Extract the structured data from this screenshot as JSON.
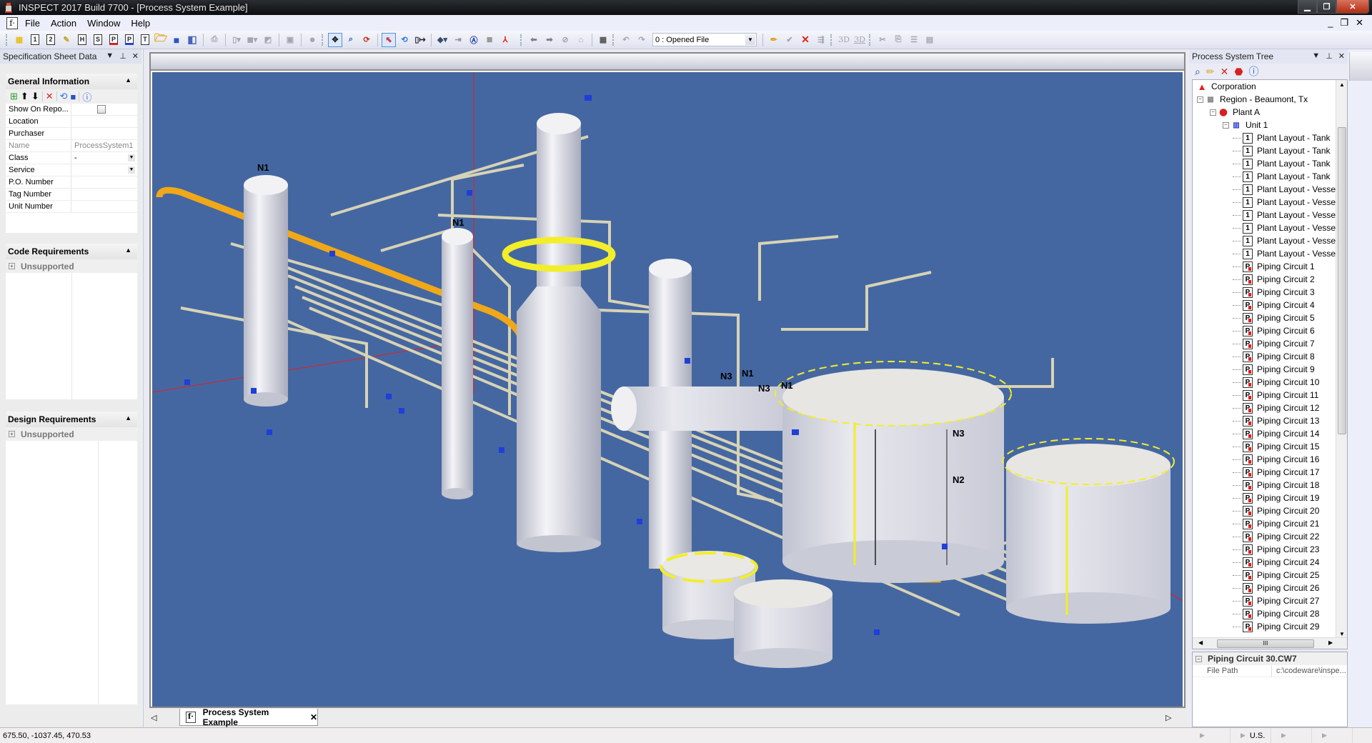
{
  "window": {
    "title": "INSPECT 2017 Build 7700 - [Process System Example]",
    "minimize_icon": "minimize-icon",
    "maximize_icon": "restore-icon",
    "close_icon": "close-icon"
  },
  "menubar": {
    "items": [
      {
        "label": "File",
        "accel": "F"
      },
      {
        "label": "Action",
        "accel": "A"
      },
      {
        "label": "Window",
        "accel": "W"
      },
      {
        "label": "Help",
        "accel": "H"
      }
    ],
    "mdi_controls": [
      "_",
      "❐",
      "✕"
    ]
  },
  "toolbar": {
    "buttons": [
      "new-project-icon",
      "tank-1-icon",
      "tank-2-icon",
      "wizard-icon",
      "heat-exchanger-icon",
      "s-icon",
      "piping-p3-icon",
      "piping-p4-icon",
      "t-icon",
      "open-icon",
      "save-icon",
      "save-all-icon",
      "print-icon",
      "report-icon",
      "component-icon",
      "edit-icon",
      "disk-icon",
      "sphere-icon",
      "pan-icon",
      "zoom-icon",
      "rotate-icon",
      "select-icon",
      "refresh-icon",
      "dimension-icon",
      "cube-icon",
      "arrow-right-icon",
      "lock-icon",
      "square-icon",
      "axis-icon",
      "back-icon",
      "forward-icon",
      "sync-icon",
      "home-icon",
      "calculator-icon",
      "undo-icon",
      "redo-icon",
      "pencil-icon",
      "check-edit-icon",
      "delete-icon",
      "merge-icon",
      "3d-icon",
      "3d-export-icon",
      "cut-icon",
      "copy-icon",
      "list-icon",
      "stack-icon"
    ],
    "file_select": {
      "value": "0 : Opened File"
    },
    "labels": {
      "b3d": "3D",
      "b3d2": "3D",
      "h": "H",
      "s": "S",
      "t": "T",
      "one": "1",
      "two": "2",
      "p3": "P",
      "p4": "P"
    }
  },
  "spec_sheet": {
    "title": "Specification Sheet Data",
    "general": {
      "title": "General Information",
      "rows": [
        {
          "key": "Show On Repo...",
          "value": "",
          "type": "checkbox",
          "checked": false
        },
        {
          "key": "Location",
          "value": ""
        },
        {
          "key": "Purchaser",
          "value": ""
        },
        {
          "key": "Name",
          "value": "ProcessSystem1",
          "dim": true
        },
        {
          "key": "Class",
          "value": "-",
          "type": "dropdown"
        },
        {
          "key": "Service",
          "value": "",
          "type": "dropdown"
        },
        {
          "key": "P.O. Number",
          "value": ""
        },
        {
          "key": "Tag Number",
          "value": ""
        },
        {
          "key": "Unit Number",
          "value": ""
        }
      ]
    },
    "code": {
      "title": "Code Requirements",
      "group": "Unsupported"
    },
    "design": {
      "title": "Design Requirements",
      "group": "Unsupported"
    }
  },
  "document": {
    "tab_label": "Process System Example",
    "nozzle_labels": [
      {
        "text": "N1"
      },
      {
        "text": "N1"
      },
      {
        "text": "N3"
      },
      {
        "text": "N1"
      },
      {
        "text": "N3"
      },
      {
        "text": "N1"
      },
      {
        "text": "N3"
      },
      {
        "text": "N2"
      }
    ],
    "colors": {
      "background": "#4567a1",
      "vessel": "#e6e6ec",
      "platform": "#f2ee2a",
      "pipe": "#d8d4b4",
      "orange_pipe": "#f0a818",
      "valve": "#1f3fd8",
      "axis": "#e02020"
    }
  },
  "tree": {
    "title": "Process System Tree",
    "toolbar": [
      "find-icon",
      "edit-icon",
      "delete-icon",
      "stop-icon",
      "help-icon"
    ],
    "root": {
      "label": "Corporation"
    },
    "region": {
      "label": "Region - Beaumont, Tx"
    },
    "plant": {
      "label": "Plant A"
    },
    "unit": {
      "label": "Unit 1"
    },
    "items": [
      {
        "label": "Plant Layout - Tank",
        "icon": "doc1"
      },
      {
        "label": "Plant Layout - Tank",
        "icon": "doc1"
      },
      {
        "label": "Plant Layout - Tank",
        "icon": "doc1"
      },
      {
        "label": "Plant Layout - Tank",
        "icon": "doc1"
      },
      {
        "label": "Plant Layout - Vessel",
        "icon": "doc1"
      },
      {
        "label": "Plant Layout - Vessel",
        "icon": "doc1"
      },
      {
        "label": "Plant Layout - Vessel",
        "icon": "doc1"
      },
      {
        "label": "Plant Layout - Vessel",
        "icon": "doc1"
      },
      {
        "label": "Plant Layout - Vessel",
        "icon": "doc1"
      },
      {
        "label": "Plant Layout - Vessel",
        "icon": "doc1"
      },
      {
        "label": "Piping Circuit 1",
        "icon": "docp"
      },
      {
        "label": "Piping Circuit 2",
        "icon": "docp"
      },
      {
        "label": "Piping Circuit 3",
        "icon": "docp"
      },
      {
        "label": "Piping Circuit 4",
        "icon": "docp"
      },
      {
        "label": "Piping Circuit 5",
        "icon": "docp"
      },
      {
        "label": "Piping Circuit 6",
        "icon": "docp"
      },
      {
        "label": "Piping Circuit 7",
        "icon": "docp"
      },
      {
        "label": "Piping Circuit 8",
        "icon": "docp"
      },
      {
        "label": "Piping Circuit 9",
        "icon": "docp"
      },
      {
        "label": "Piping Circuit 10",
        "icon": "docp"
      },
      {
        "label": "Piping Circuit 11",
        "icon": "docp"
      },
      {
        "label": "Piping Circuit 12",
        "icon": "docp"
      },
      {
        "label": "Piping Circuit 13",
        "icon": "docp"
      },
      {
        "label": "Piping Circuit 14",
        "icon": "docp"
      },
      {
        "label": "Piping Circuit 15",
        "icon": "docp"
      },
      {
        "label": "Piping Circuit 16",
        "icon": "docp"
      },
      {
        "label": "Piping Circuit 17",
        "icon": "docp"
      },
      {
        "label": "Piping Circuit 18",
        "icon": "docp"
      },
      {
        "label": "Piping Circuit 19",
        "icon": "docp"
      },
      {
        "label": "Piping Circuit 20",
        "icon": "docp"
      },
      {
        "label": "Piping Circuit 21",
        "icon": "docp"
      },
      {
        "label": "Piping Circuit 22",
        "icon": "docp"
      },
      {
        "label": "Piping Circuit 23",
        "icon": "docp"
      },
      {
        "label": "Piping Circuit 24",
        "icon": "docp"
      },
      {
        "label": "Piping Circuit 25",
        "icon": "docp"
      },
      {
        "label": "Piping Circuit 26",
        "icon": "docp"
      },
      {
        "label": "Piping Circuit 27",
        "icon": "docp"
      },
      {
        "label": "Piping Circuit 28",
        "icon": "docp"
      },
      {
        "label": "Piping Circuit 29",
        "icon": "docp"
      }
    ],
    "scroll_thumb_label": "III"
  },
  "selected_props": {
    "title": "Piping Circuit  30.CW7",
    "rows": [
      {
        "key": "File Path",
        "value": "c:\\codeware\\inspe..."
      }
    ]
  },
  "statusbar": {
    "coords": "675.50, -1037.45, 470.53",
    "units": "U.S."
  }
}
